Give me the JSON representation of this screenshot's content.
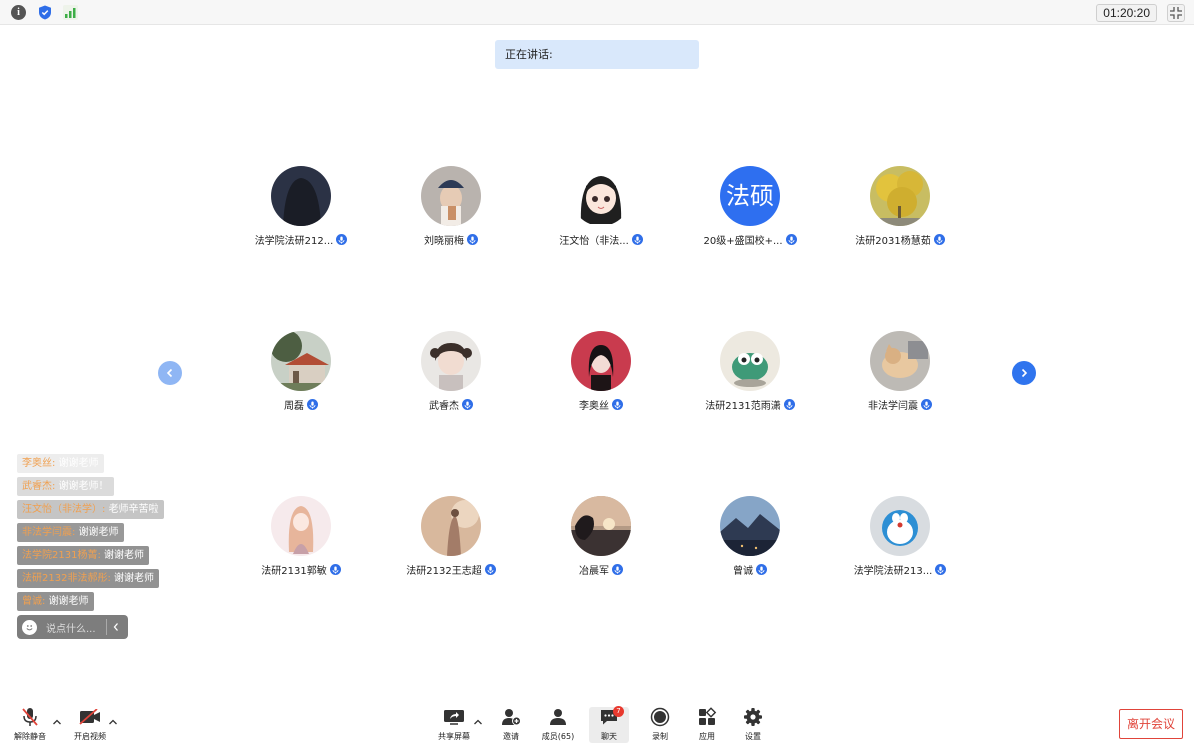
{
  "topbar": {
    "timer": "01:20:20",
    "icons": [
      "info-icon",
      "shield-icon",
      "signal-icon",
      "exit-fullscreen-icon"
    ]
  },
  "speaking": {
    "label": "正在讲话:"
  },
  "participants": [
    {
      "name": "法学院法研212...",
      "avatar": "photo-dark-hair"
    },
    {
      "name": "刘晓丽梅",
      "avatar": "photo-cap"
    },
    {
      "name": "汪文怡（非法...",
      "avatar": "cartoon-girl"
    },
    {
      "name": "20级+盛国校+...",
      "avatar": "text",
      "avatar_text": "法硕"
    },
    {
      "name": "法研2031杨慧茹",
      "avatar": "photo-ginkgo"
    },
    {
      "name": "周磊",
      "avatar": "photo-house"
    },
    {
      "name": "武睿杰",
      "avatar": "photo-child"
    },
    {
      "name": "李奥丝",
      "avatar": "photo-red"
    },
    {
      "name": "法研2131范雨潇",
      "avatar": "photo-toy"
    },
    {
      "name": "非法学闫震",
      "avatar": "photo-cat"
    },
    {
      "name": "法研2131郭敏",
      "avatar": "photo-anime"
    },
    {
      "name": "法研2132王志超",
      "avatar": "photo-sepia"
    },
    {
      "name": "冶晨军",
      "avatar": "photo-sunset"
    },
    {
      "name": "曾诚",
      "avatar": "photo-mountain"
    },
    {
      "name": "法学院法研213...",
      "avatar": "photo-doraemon"
    }
  ],
  "chat": {
    "messages": [
      {
        "sender": "李奥丝:",
        "text": "谢谢老师",
        "opacity": 0.12
      },
      {
        "sender": "武睿杰:",
        "text": "谢谢老师！",
        "opacity": 0.25
      },
      {
        "sender": "汪文怡（非法学）:",
        "text": "老师辛苦啦",
        "opacity": 0.4
      },
      {
        "sender": "非法学闫震:",
        "text": "谢谢老师",
        "opacity": 0.7
      },
      {
        "sender": "法学院2131杨菁:",
        "text": "谢谢老师",
        "opacity": 0.75
      },
      {
        "sender": "法研2132非法郝彤:",
        "text": "谢谢老师",
        "opacity": 0.75
      },
      {
        "sender": "曾诚:",
        "text": "谢谢老师",
        "opacity": 0.75
      }
    ],
    "placeholder": "说点什么..."
  },
  "toolbar": {
    "unmute": "解除静音",
    "start_video": "开启视频",
    "share_screen": "共享屏幕",
    "invite": "邀请",
    "members": "成员(65)",
    "chat": "聊天",
    "chat_badge": "7",
    "record": "录制",
    "apps": "应用",
    "settings": "设置",
    "leave": "离开会议"
  },
  "colors": {
    "accent": "#2f6ee8",
    "leave": "#e0443a",
    "badge": "#e8392e"
  }
}
